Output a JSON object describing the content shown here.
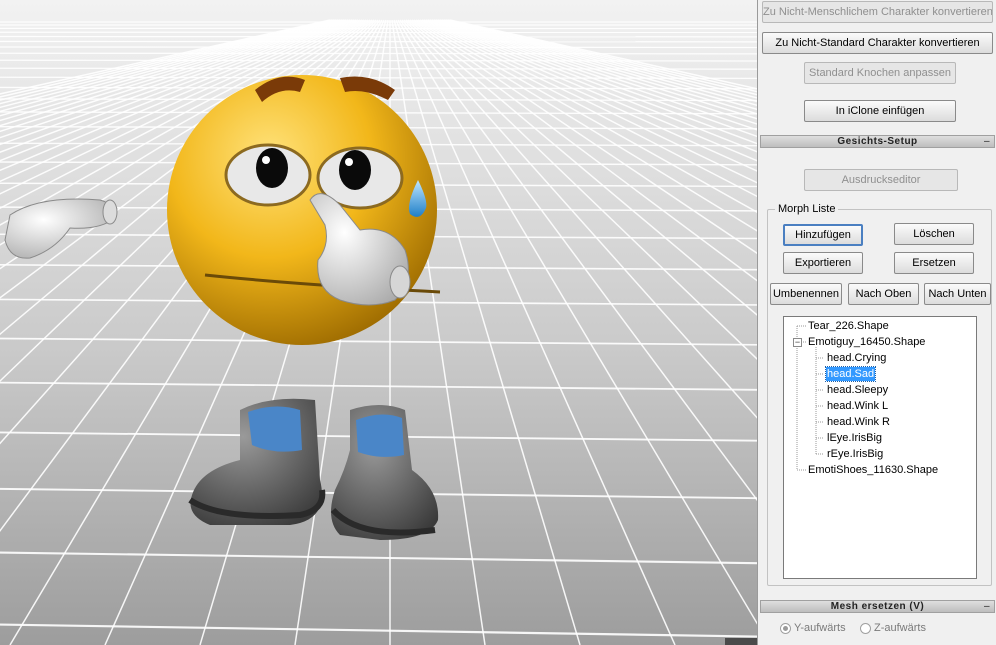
{
  "buttons": {
    "convert_nonhuman": "Zu Nicht-Menschlichem Charakter konvertieren",
    "convert_nonstandard": "Zu Nicht-Standard Charakter konvertieren",
    "adjust_bones": "Standard Knochen anpassen",
    "insert_iclone": "In iClone einfügen",
    "expression_editor": "Ausdruckseditor"
  },
  "sections": {
    "face_setup": "Gesichts-Setup",
    "mesh_replace": "Mesh ersetzen (V)",
    "collapse": "–"
  },
  "morph": {
    "group_label": "Morph Liste",
    "add": "Hinzufügen",
    "delete": "Löschen",
    "export": "Exportieren",
    "replace": "Ersetzen",
    "rename": "Umbenennen",
    "move_up": "Nach Oben",
    "move_down": "Nach Unten",
    "tree": [
      {
        "label": "Tear_226.Shape",
        "level": 0,
        "expander": false,
        "selected": false
      },
      {
        "label": "Emotiguy_16450.Shape",
        "level": 0,
        "expander": true,
        "selected": false
      },
      {
        "label": "head.Crying",
        "level": 1,
        "expander": false,
        "selected": false
      },
      {
        "label": "head.Sad",
        "level": 1,
        "expander": false,
        "selected": true
      },
      {
        "label": "head.Sleepy",
        "level": 1,
        "expander": false,
        "selected": false
      },
      {
        "label": "head.Wink L",
        "level": 1,
        "expander": false,
        "selected": false
      },
      {
        "label": "head.Wink R",
        "level": 1,
        "expander": false,
        "selected": false
      },
      {
        "label": "lEye.IrisBig",
        "level": 1,
        "expander": false,
        "selected": false
      },
      {
        "label": "rEye.IrisBig",
        "level": 1,
        "expander": false,
        "selected": false
      },
      {
        "label": "EmotiShoes_11630.Shape",
        "level": 0,
        "expander": false,
        "selected": false
      }
    ]
  },
  "mesh": {
    "y_up": "Y-aufwärts",
    "z_up": "Z-aufwärts",
    "selected": "Y-aufwärts"
  },
  "viewport": {
    "character": "crying emoticon character"
  },
  "colors": {
    "selection": "#3399ff",
    "focus_border": "#4a7fc1",
    "face_yellow": "#f2b71a"
  }
}
